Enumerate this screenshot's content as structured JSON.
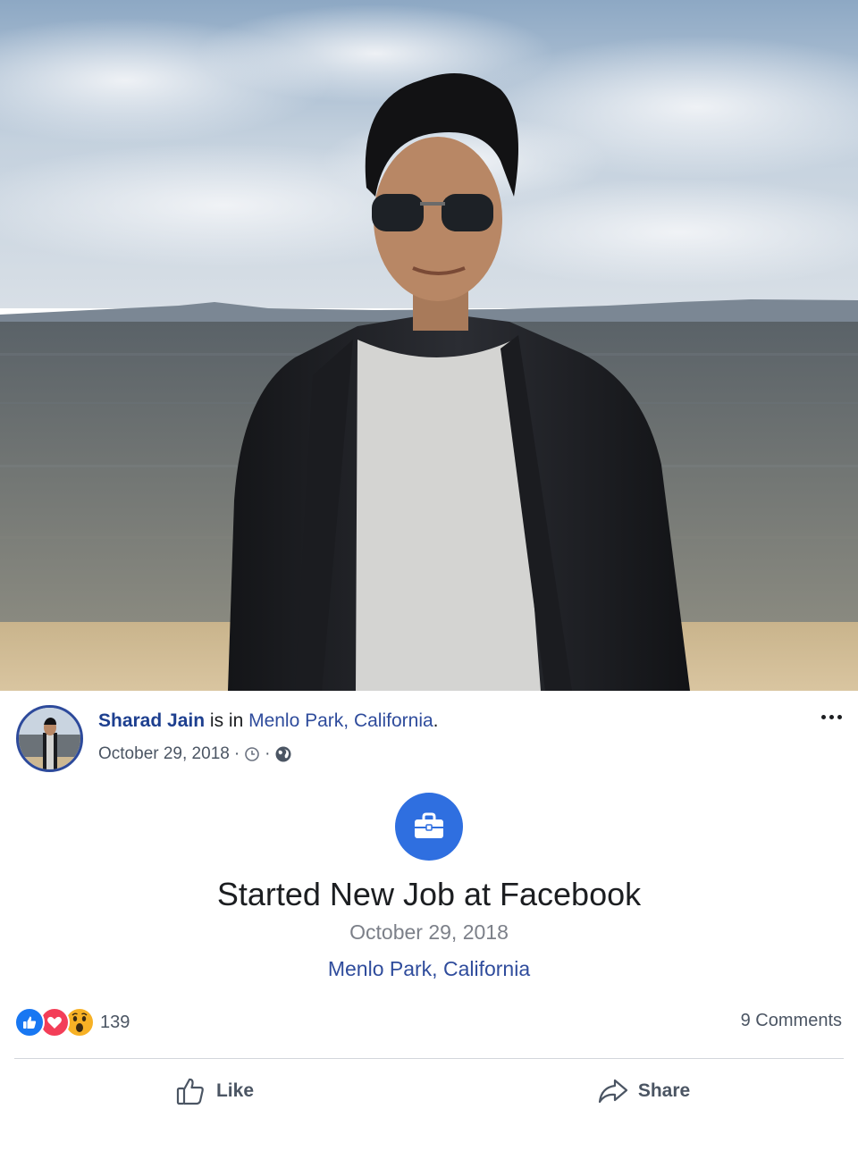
{
  "post": {
    "author": "Sharad Jain",
    "verb": " is in ",
    "location": "Menlo Park, California",
    "location_end": ".",
    "date": "October 29, 2018",
    "meta_separator": "·",
    "privacy_icon": "globe-icon",
    "time_icon": "clock-icon",
    "more_icon": "ellipsis-icon"
  },
  "life_event": {
    "icon": "briefcase-icon",
    "icon_color": "#2f6fe0",
    "title": "Started New Job at Facebook",
    "date": "October 29, 2018",
    "location": "Menlo Park, California"
  },
  "reactions": {
    "types": [
      "like",
      "love",
      "wow"
    ],
    "colors": {
      "like": "#1877f2",
      "love": "#f33e58",
      "wow": "#f7b125"
    },
    "count": "139"
  },
  "comments": {
    "label": "9 Comments"
  },
  "actions": {
    "like_label": "Like",
    "share_label": "Share"
  },
  "colors": {
    "link": "#2f4c9c",
    "author": "#1d3f8f",
    "muted": "#4b5563"
  }
}
